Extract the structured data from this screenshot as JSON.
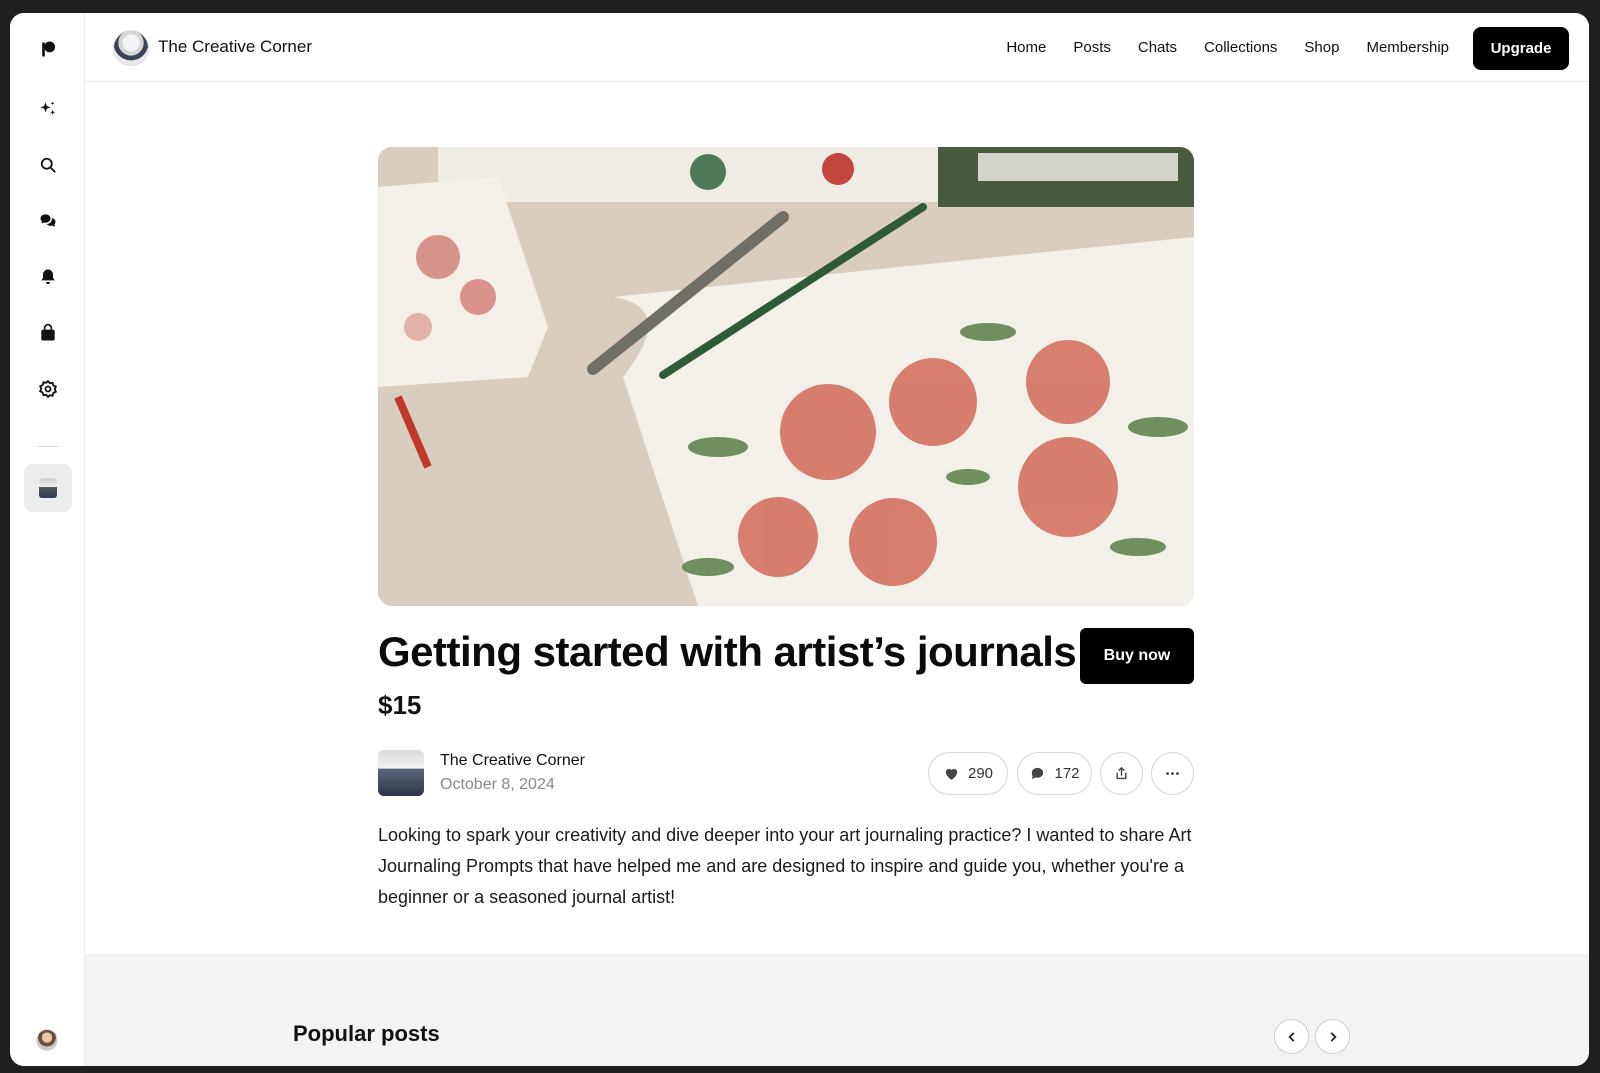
{
  "rail": {
    "icons": [
      "patreon-logo-icon",
      "sparkles-icon",
      "search-icon",
      "chat-bubbles-icon",
      "bell-icon",
      "shopping-bag-icon",
      "settings-gear-icon"
    ]
  },
  "topbar": {
    "creator_name": "The Creative Corner",
    "nav": [
      "Home",
      "Posts",
      "Chats",
      "Collections",
      "Shop",
      "Membership"
    ],
    "upgrade_label": "Upgrade"
  },
  "post": {
    "title": "Getting started with artist’s journals",
    "buy_label": "Buy now",
    "price": "$15",
    "author": "The Creative Corner",
    "date": "October 8, 2024",
    "likes": "290",
    "comments": "172",
    "body": "Looking to spark your creativity and dive deeper into your art journaling practice? I wanted to share Art Journaling Prompts that have helped me and are designed to inspire and guide you, whether you're a beginner or a seasoned journal artist!"
  },
  "popular": {
    "title": "Popular posts"
  },
  "colors": {
    "accent": "#000000",
    "muted_text": "#8a8a8a",
    "section_bg": "#f3f3f3"
  }
}
